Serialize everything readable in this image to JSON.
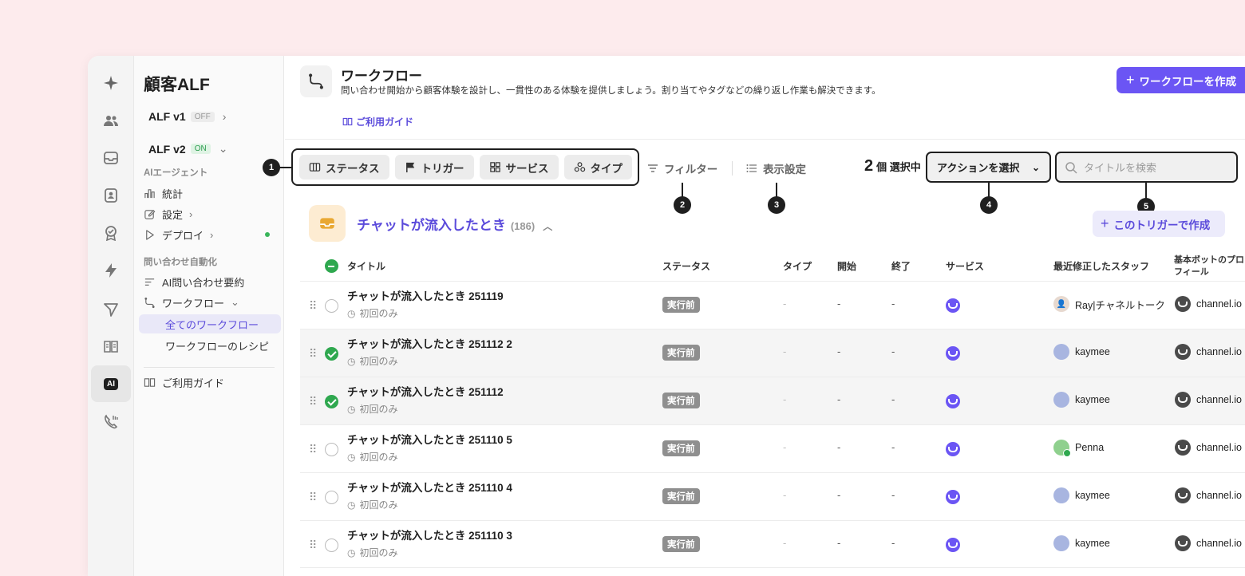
{
  "app": {
    "sidebar_title": "顧客ALF",
    "versions": [
      {
        "label": "ALF v1",
        "badge": "OFF"
      },
      {
        "label": "ALF v2",
        "badge": "ON"
      }
    ],
    "section_ai_agent": "AIエージェント",
    "nav_ai": [
      "統計",
      "設定",
      "デプロイ"
    ],
    "section_inquiry": "問い合わせ自動化",
    "nav_inquiry_summary": "AI問い合わせ要約",
    "nav_workflow": "ワークフロー",
    "nav_workflow_all": "全てのワークフロー",
    "nav_workflow_recipe": "ワークフローのレシピ",
    "nav_guide": "ご利用ガイド"
  },
  "header": {
    "title": "ワークフロー",
    "description": "問い合わせ開始から顧客体験を設計し、一貫性のある体験を提供しましょう。割り当てやタグなどの繰り返し作業も解決できます。",
    "guide_link": "ご利用ガイド",
    "create_button": "ワークフローを作成"
  },
  "toolbar": {
    "chips": [
      "ステータス",
      "トリガー",
      "サービス",
      "タイプ"
    ],
    "filter": "フィルター",
    "display_settings": "表示設定",
    "selected_count": "2",
    "selected_suffix": "個 選択中",
    "action_select": "アクションを選択",
    "search_placeholder": "タイトルを検索"
  },
  "callouts": [
    "1",
    "2",
    "3",
    "4",
    "5"
  ],
  "group": {
    "title": "チャットが流入したとき",
    "count": "(186)",
    "create_with_trigger": "このトリガーで作成"
  },
  "table": {
    "headers": {
      "title": "タイトル",
      "status": "ステータス",
      "type": "タイプ",
      "start": "開始",
      "end": "終了",
      "service": "サービス",
      "modified_by": "最近修正したスタッフ",
      "bot_profile": "基本ボットのプロフィール"
    },
    "rows": [
      {
        "title": "チャットが流入したとき 251119",
        "sub": "初回のみ",
        "status": "実行前",
        "type": "-",
        "start": "-",
        "end": "-",
        "staff": "Ray|チャネルトーク",
        "bot": "channel.io",
        "checked": false
      },
      {
        "title": "チャットが流入したとき 251112 2",
        "sub": "初回のみ",
        "status": "実行前",
        "type": "-",
        "start": "-",
        "end": "-",
        "staff": "kaymee",
        "bot": "channel.io",
        "checked": true
      },
      {
        "title": "チャットが流入したとき 251112",
        "sub": "初回のみ",
        "status": "実行前",
        "type": "-",
        "start": "-",
        "end": "-",
        "staff": "kaymee",
        "bot": "channel.io",
        "checked": true
      },
      {
        "title": "チャットが流入したとき 251110 5",
        "sub": "初回のみ",
        "status": "実行前",
        "type": "-",
        "start": "-",
        "end": "-",
        "staff": "Penna",
        "bot": "channel.io",
        "checked": false
      },
      {
        "title": "チャットが流入したとき 251110 4",
        "sub": "初回のみ",
        "status": "実行前",
        "type": "-",
        "start": "-",
        "end": "-",
        "staff": "kaymee",
        "bot": "channel.io",
        "checked": false
      },
      {
        "title": "チャットが流入したとき 251110 3",
        "sub": "初回のみ",
        "status": "実行前",
        "type": "-",
        "start": "-",
        "end": "-",
        "staff": "kaymee",
        "bot": "channel.io",
        "checked": false
      }
    ]
  },
  "colors": {
    "accent": "#6b55f4",
    "check": "#2fa84f",
    "status_gray": "#8f8f8f",
    "background": "#fdebed"
  }
}
